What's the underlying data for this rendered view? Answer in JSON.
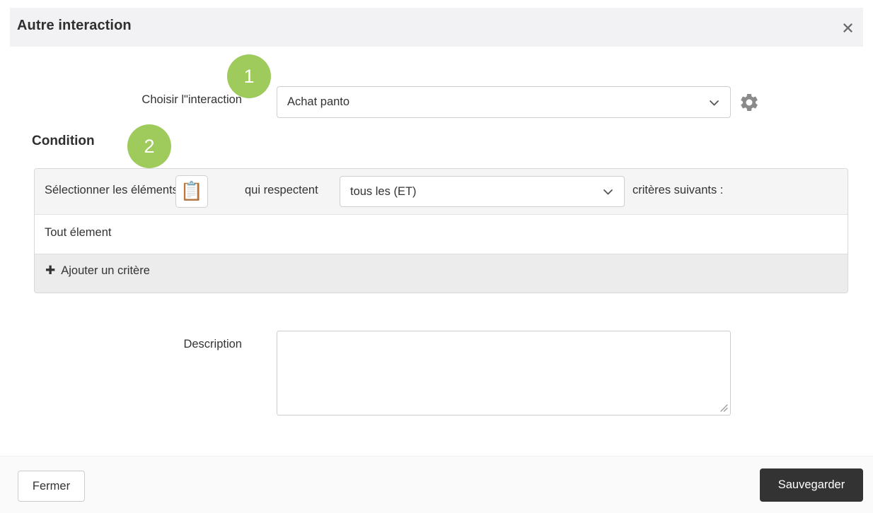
{
  "modal": {
    "title": "Autre interaction",
    "close_icon": "close-icon",
    "close_glyph": "✖"
  },
  "badges": [
    {
      "label": "1",
      "color": "#9fca5c"
    },
    {
      "label": "2",
      "color": "#9fca5c"
    }
  ],
  "interaction": {
    "label": "Choisir l\"interaction",
    "selected": "Achat panto",
    "chevron_icon": "chevron-down-icon",
    "settings_icon": "gear-icon"
  },
  "condition": {
    "heading": "Condition",
    "text_before": "Sélectionner les éléments",
    "clipboard_icon": "clipboard-icon",
    "clipboard_glyph": "📋",
    "text_middle": "qui respectent",
    "operator_selected": "tous les (ET)",
    "text_after": "critères suivants :",
    "item_label": "Tout élement",
    "add_label": "Ajouter un critère",
    "add_icon_glyph": "➕"
  },
  "description": {
    "label": "Description",
    "value": "",
    "placeholder": ""
  },
  "footer": {
    "close_label": "Fermer",
    "save_label": "Sauvegarder"
  }
}
